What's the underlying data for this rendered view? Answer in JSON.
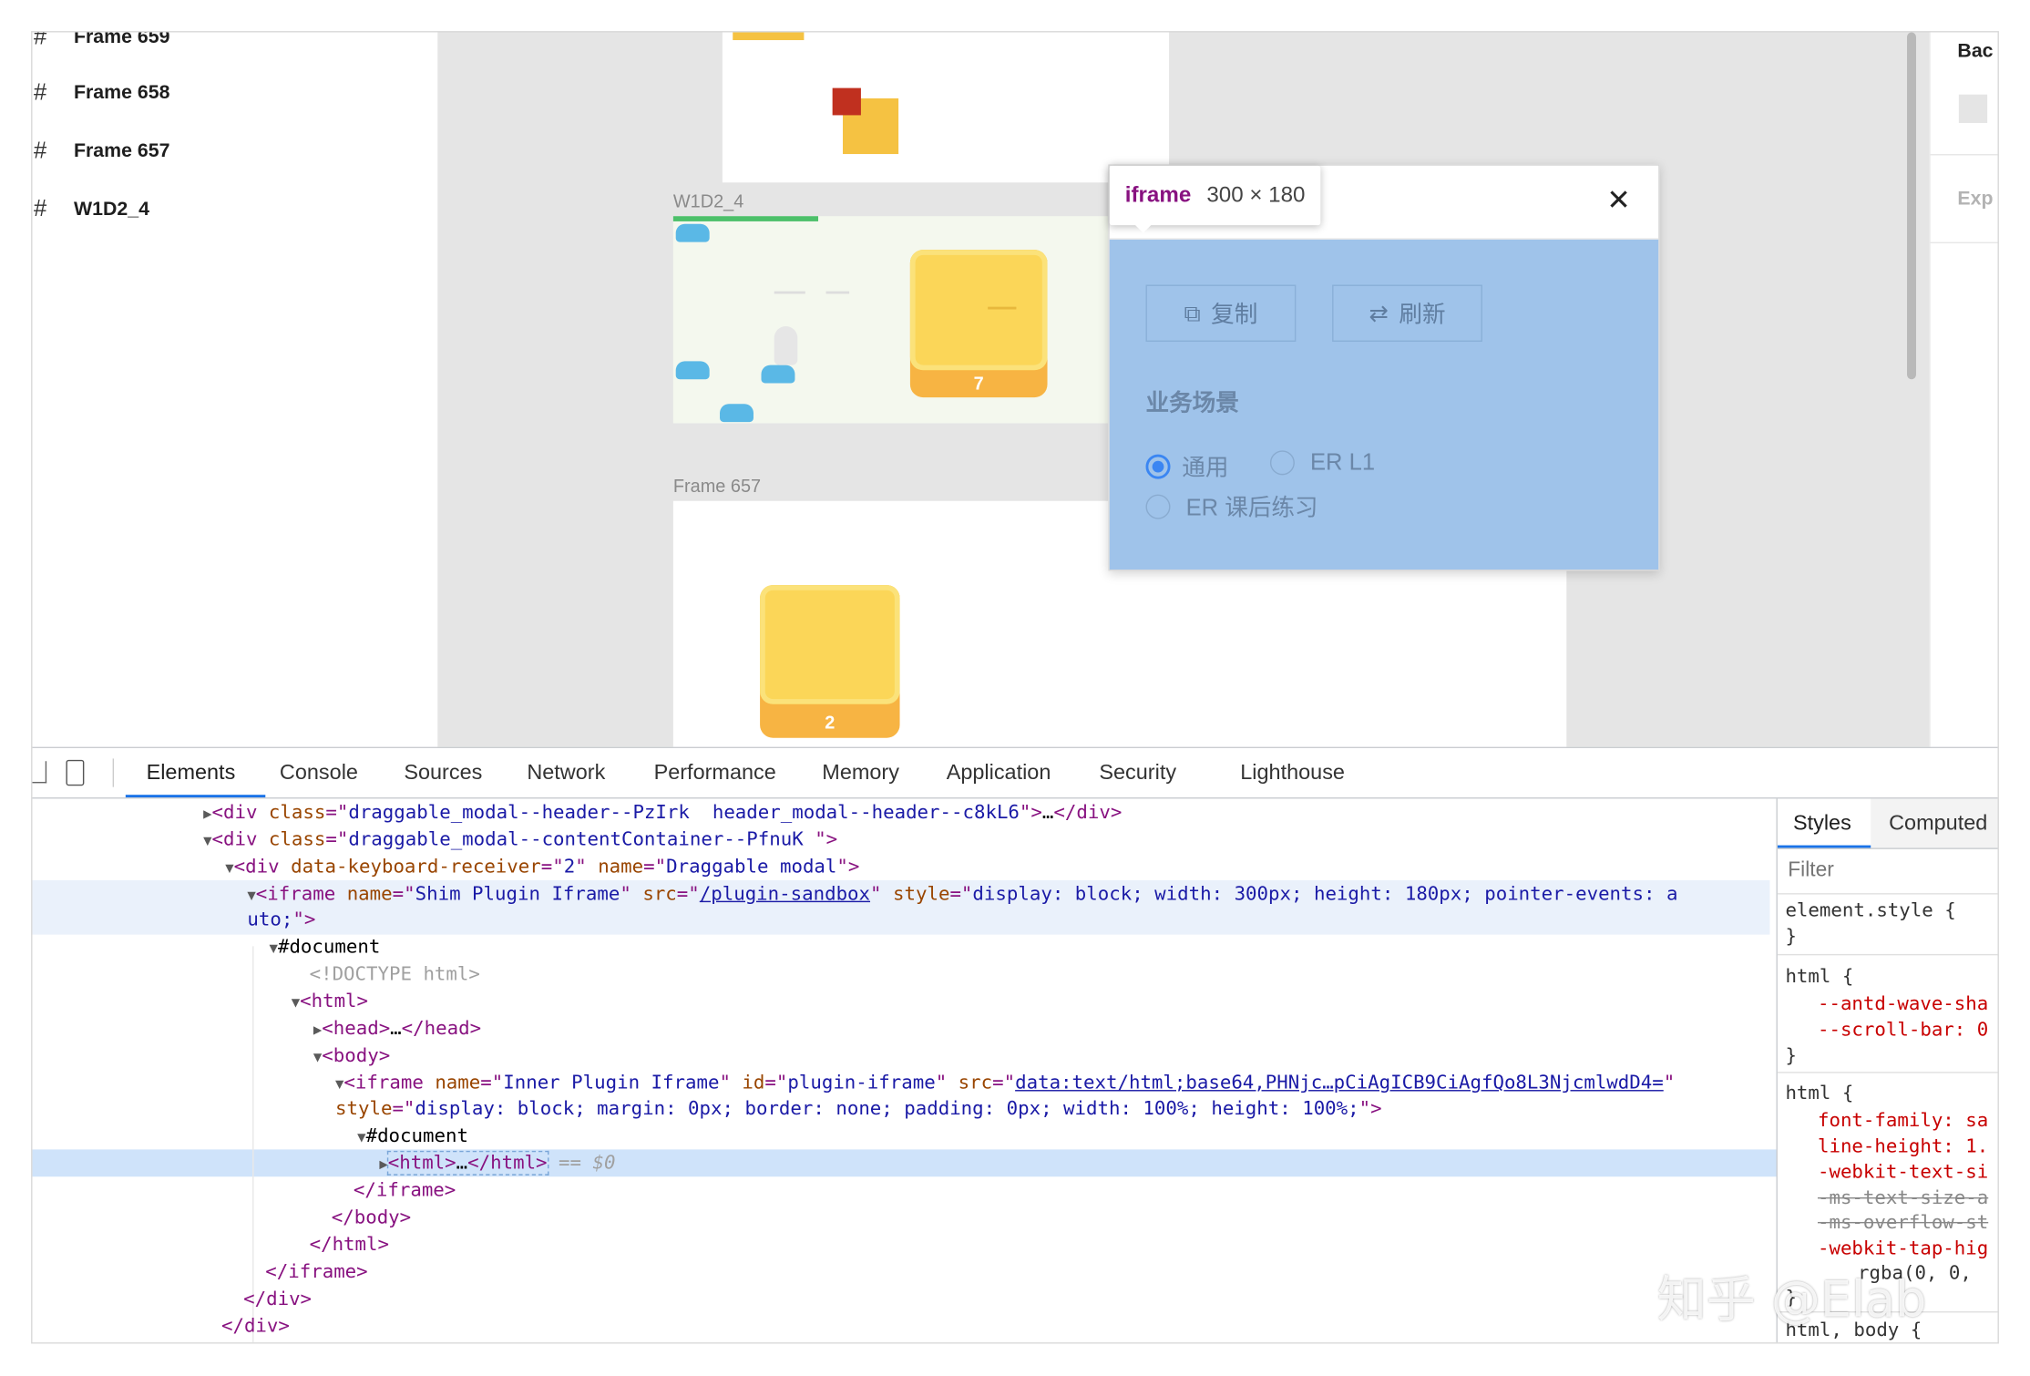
{
  "layers": {
    "items": [
      {
        "label": "Frame 659"
      },
      {
        "label": "Frame 658"
      },
      {
        "label": "Frame 657"
      },
      {
        "label": "W1D2_4"
      }
    ]
  },
  "canvas": {
    "frame_labels": {
      "w1d2": "W1D2_4",
      "f657": "Frame 657"
    },
    "card_numbers": {
      "w1d2": "7",
      "f657": "2"
    }
  },
  "right_panel": {
    "bg_label": "Bac",
    "export_label": "Exp"
  },
  "popup": {
    "tag": "iframe",
    "size": "300 × 180",
    "copy_label": "复制",
    "refresh_label": "刷新",
    "section_title": "业务场景",
    "radios": [
      {
        "label": "通用",
        "checked": true
      },
      {
        "label": "ER L1",
        "checked": false
      },
      {
        "label": "ER 课后练习",
        "checked": false
      }
    ]
  },
  "devtools": {
    "tabs": [
      "Elements",
      "Console",
      "Sources",
      "Network",
      "Performance",
      "Memory",
      "Application",
      "Security",
      "Lighthouse"
    ],
    "active_tab": "Elements",
    "styles_tabs": [
      "Styles",
      "Computed"
    ],
    "filter_placeholder": "Filter",
    "dom": {
      "header_class": "draggable_modal--header--PzIrk  header_modal--header--c8kL6",
      "content_class": "draggable_modal--contentContainer--PfnuK ",
      "receiver": "2",
      "modal_name": "Draggable modal",
      "shim_name": "Shim Plugin Iframe",
      "shim_src": "/plugin-sandbox",
      "shim_style_1": "display: block; width: 300px; height: 180px; pointer-events: a",
      "shim_style_2": "uto;",
      "doctype": "<!DOCTYPE html>",
      "document": "#document",
      "inner_name": "Inner Plugin Iframe",
      "inner_id": "plugin-iframe",
      "inner_src": "data:text/html;base64,PHNjc…pCiAgICB9CiAgfQo8L3NjcmlwdD4=",
      "inner_style": "display: block; margin: 0px; border: none; padding: 0px; width: 100%; height: 100%;",
      "selected_marker": "== $0"
    },
    "styles": {
      "element_style": "element.style {",
      "html_rule_1": [
        "--antd-wave-sha",
        "--scroll-bar: 0"
      ],
      "html_rule_2": [
        "font-family: sa",
        "line-height: 1.",
        "-webkit-text-si",
        "-ms-text-size-a",
        "-ms-overflow-st",
        "-webkit-tap-hig",
        "rgba(0, 0,"
      ],
      "last_selector": "html, body {"
    }
  },
  "watermark": "知乎 @Elab"
}
